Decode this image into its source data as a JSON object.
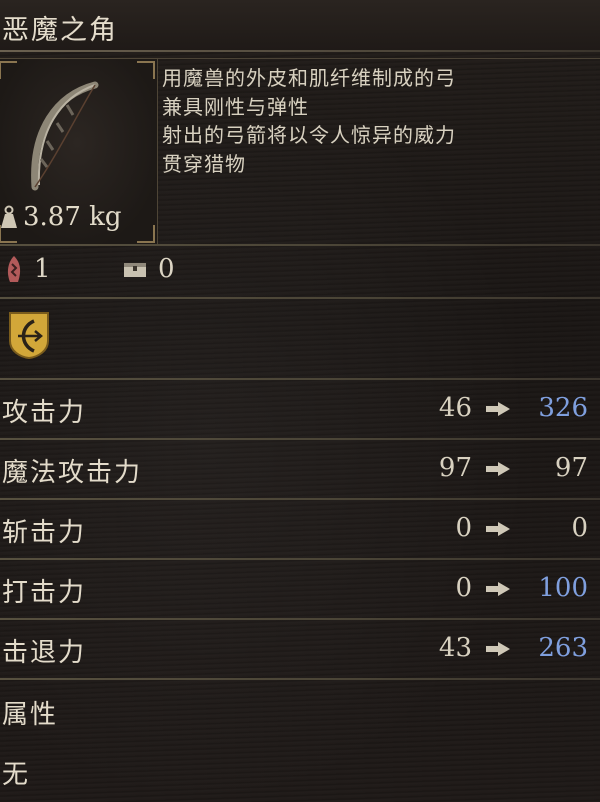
{
  "item": {
    "name": "恶魔之角",
    "weight": "3.87 kg",
    "description": [
      "用魔兽的外皮和肌纤维制成的弓",
      "兼具刚性与弹性",
      "射出的弓箭将以令人惊异的威力",
      "贯穿猎物"
    ]
  },
  "counts": {
    "enhance": "1",
    "storage": "0"
  },
  "stats": [
    {
      "label": "攻击力",
      "base": "46",
      "new": "326",
      "new_color": "#7f9fde"
    },
    {
      "label": "魔法攻击力",
      "base": "97",
      "new": "97",
      "new_color": "#d8d1c0"
    },
    {
      "label": "斩击力",
      "base": "0",
      "new": "0",
      "new_color": "#d8d1c0"
    },
    {
      "label": "打击力",
      "base": "0",
      "new": "100",
      "new_color": "#7f9fde"
    },
    {
      "label": "击退力",
      "base": "43",
      "new": "263",
      "new_color": "#7f9fde"
    }
  ],
  "attribute": {
    "label": "属性",
    "value": "无"
  },
  "icons": {
    "bow": "bow-icon",
    "weight": "weight-icon",
    "enhance": "enhance-icon",
    "storage": "storage-chest-icon",
    "weapon_type": "bow-class-badge-icon"
  },
  "colors": {
    "upgrade": "#7f9fde",
    "text": "#ddd6c6",
    "gold": "#d2a739"
  }
}
